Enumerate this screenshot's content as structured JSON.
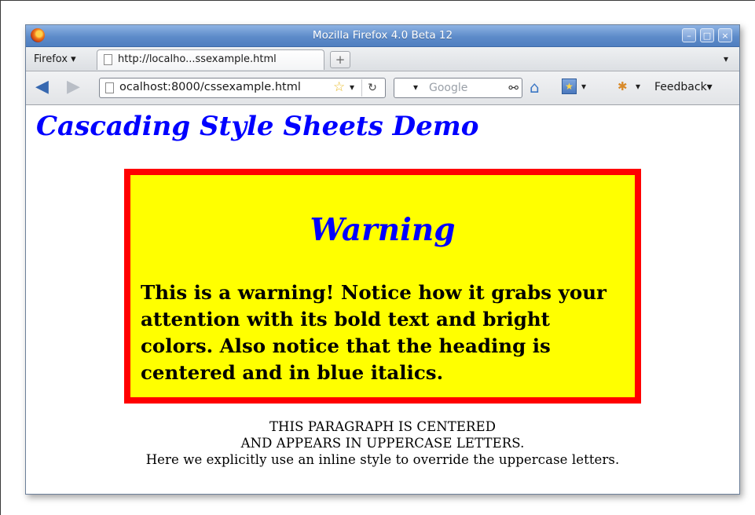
{
  "window": {
    "title": "Mozilla Firefox 4.0 Beta 12",
    "controls": {
      "minimize": "–",
      "maximize": "□",
      "close": "×"
    }
  },
  "tabbar": {
    "menu_button": "Firefox",
    "tabs": [
      {
        "label": "http://localho...ssexample.html",
        "icon": "page-icon"
      }
    ],
    "new_tab": "+",
    "tab_list": "▾"
  },
  "navbar": {
    "back_icon": "back-arrow-icon",
    "forward_icon": "forward-arrow-icon",
    "url": "ocalhost:8000/cssexample.html",
    "star": "☆",
    "dropdown": "▾",
    "reload": "↻",
    "search": {
      "placeholder": "Google",
      "dropdown": "▾",
      "go": "⚲"
    },
    "home_icon": "home-icon",
    "bookmarks_icon": "bookmarks-icon",
    "feedback_label": "Feedback"
  },
  "page": {
    "heading": "Cascading Style Sheets Demo",
    "warning": {
      "title": "Warning",
      "text": "This is a warning! Notice how it grabs your attention with its bold text and bright colors. Also notice that the heading is centered and in blue italics."
    },
    "centered_lines": [
      "THIS PARAGRAPH IS CENTERED",
      "AND APPEARS IN UPPERCASE LETTERS.",
      "Here we explicitly use an inline style to override the uppercase letters."
    ]
  },
  "colors": {
    "heading": "#0000ff",
    "warning_background": "#ffff00",
    "warning_border": "#ff0000",
    "titlebar": "#5d8bc9"
  }
}
